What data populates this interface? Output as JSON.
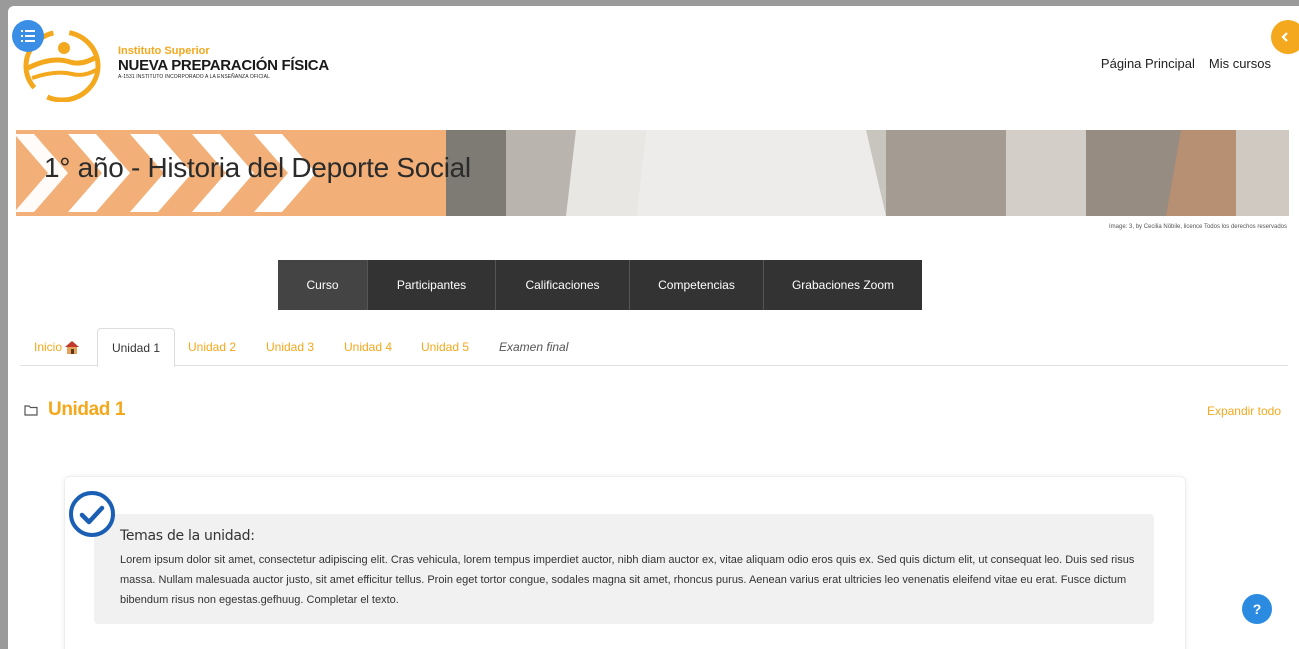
{
  "header": {
    "logo_sub": "Instituto Superior",
    "logo_main": "NUEVA PREPARACIÓN FÍSICA",
    "logo_small": "A-1531 INSTITUTO INCORPORADO A LA ENSEÑANZA OFICIAL",
    "nav": [
      "Página Principal",
      "Mis cursos"
    ]
  },
  "banner": {
    "title": "1° año - Historia del Deporte Social",
    "credit": "Image: 3, by Cecilia Nöbile, licence Todos los derechos reservados"
  },
  "course_menu": {
    "items": [
      "Curso",
      "Participantes",
      "Calificaciones",
      "Competencias",
      "Grabaciones Zoom"
    ],
    "active": "Curso"
  },
  "tabs": {
    "items": [
      "Inicio",
      "Unidad 1",
      "Unidad 2",
      "Unidad 3",
      "Unidad 4",
      "Unidad 5",
      "Examen final"
    ],
    "active": "Unidad 1"
  },
  "section": {
    "title": "Unidad 1",
    "expand_label": "Expandir todo",
    "card_title": "Temas de la unidad:",
    "card_text": "Lorem ipsum dolor sit amet, consectetur adipiscing elit. Cras vehicula, lorem tempus imperdiet auctor, nibh diam auctor ex, vitae aliquam odio eros quis ex. Sed quis dictum elit, ut consequat leo. Duis sed risus massa. Nullam malesuada auctor justo, sit amet efficitur tellus. Proin eget tortor congue, sodales magna sit amet, rhoncus purus. Aenean varius erat ultricies leo venenatis eleifend vitae eu erat. Fusce dictum bibendum risus non egestas.gefhuug. Completar el texto."
  },
  "help": {
    "label": "?"
  },
  "icons": {
    "drawer": "list-icon",
    "collapse": "chevron-left-icon",
    "home": "house-icon",
    "folder": "folder-icon",
    "check": "check-circle-icon",
    "help": "question-icon"
  },
  "colors": {
    "accent": "#f4a81d",
    "menu_bg": "#333333",
    "blue": "#2a8be0",
    "check_blue": "#1a5fb4",
    "banner_orange": "#f2b078"
  }
}
